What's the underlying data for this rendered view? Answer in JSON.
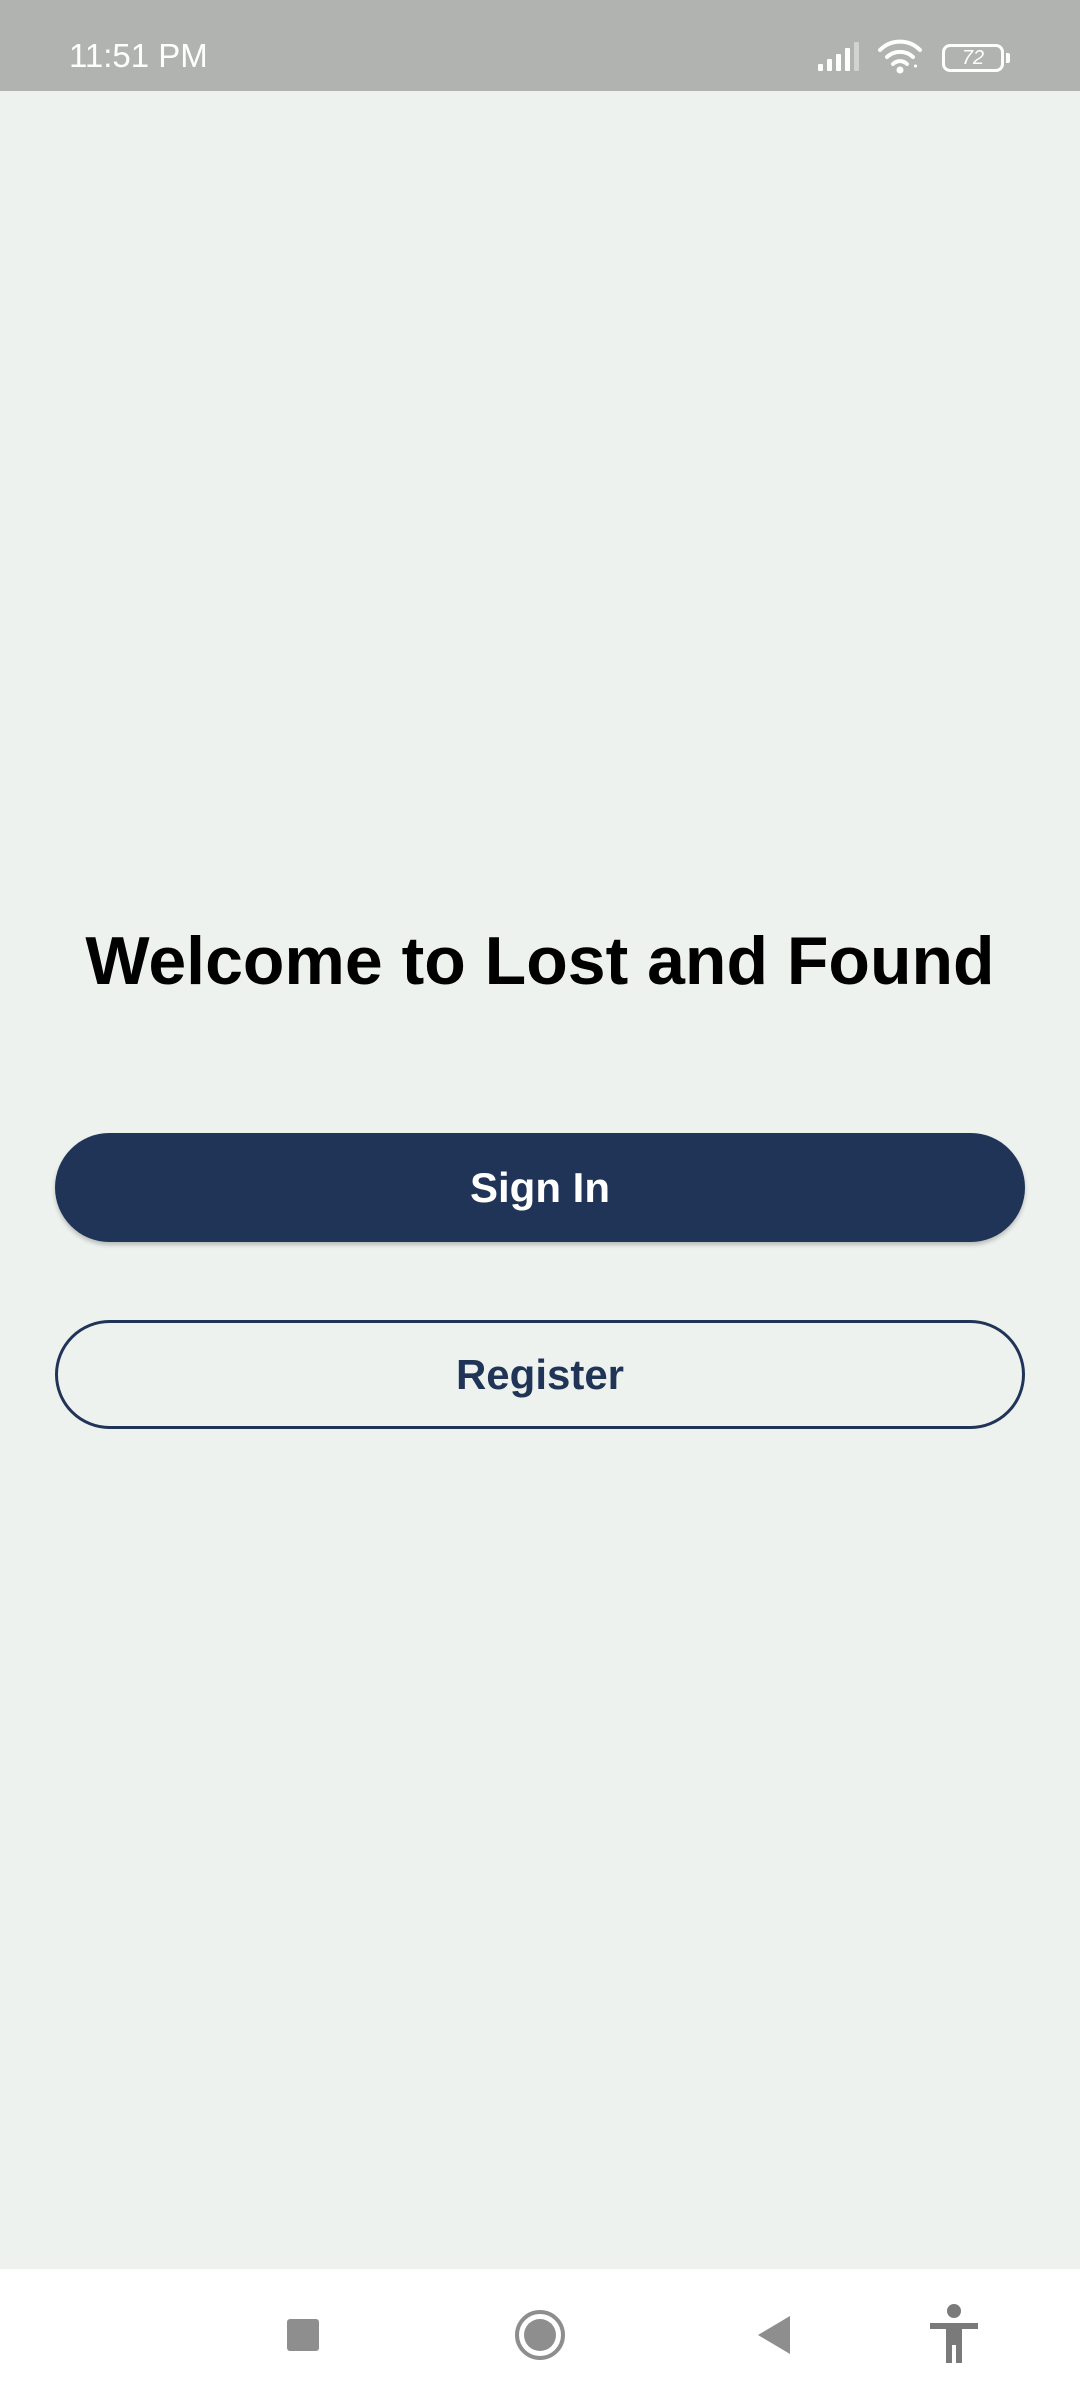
{
  "status_bar": {
    "time": "11:51 PM",
    "battery_level": "72",
    "icons": [
      "signal-icon",
      "wifi-icon",
      "battery-icon"
    ]
  },
  "main": {
    "title": "Welcome to Lost and Found",
    "sign_in_label": "Sign In",
    "register_label": "Register"
  },
  "nav_bar": {
    "items": [
      "recents-icon",
      "home-icon",
      "back-icon",
      "accessibility-icon"
    ]
  },
  "colors": {
    "primary": "#1F3457",
    "background": "#EEF2EE",
    "status_bar": "#B0B3AF",
    "nav_icons": "#8E8E8E"
  }
}
